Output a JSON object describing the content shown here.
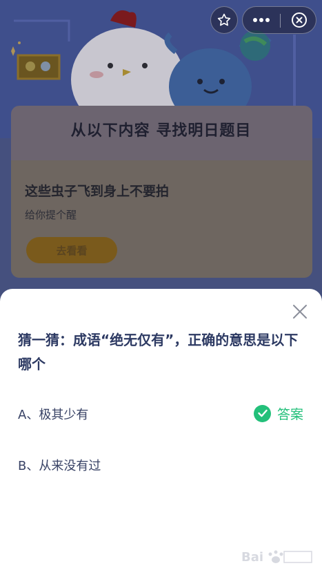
{
  "background": {
    "panel_title": "从以下内容 寻找明日题目",
    "card": {
      "title": "这些虫子飞到身上不要拍",
      "subtitle": "给你提个醒",
      "button_label": "去看看"
    }
  },
  "colors": {
    "accent_green": "#23c07a",
    "question_text": "#2d3a63",
    "option_text": "#384265"
  },
  "icons": {
    "star": "star-icon",
    "more": "more-dots-icon",
    "close_mini": "close-circle-icon",
    "sheet_close": "close-icon",
    "check": "check-icon"
  },
  "quiz": {
    "question": "猜一猜：成语“绝无仅有”，正确的意思是以下哪个",
    "options": [
      {
        "label": "A、极其少有",
        "is_answer": true
      },
      {
        "label": "B、从来没有过",
        "is_answer": false
      }
    ],
    "answer_label": "答案"
  }
}
